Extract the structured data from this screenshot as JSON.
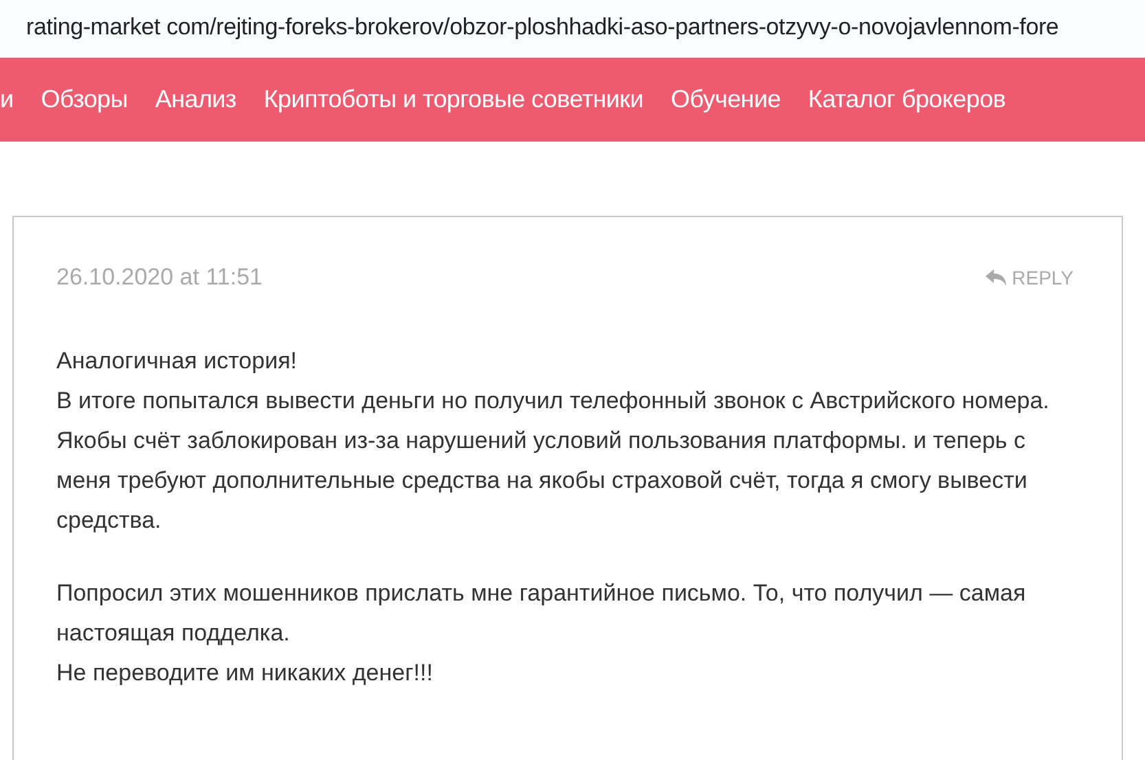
{
  "address_bar": {
    "url": "rating-market com/rejting-foreks-brokerov/obzor-ploshhadki-aso-partners-otzyvy-o-novojavlennom-fore"
  },
  "nav": {
    "items": [
      {
        "label": "и"
      },
      {
        "label": "Обзоры"
      },
      {
        "label": "Анализ"
      },
      {
        "label": "Криптоботы и торговые советники"
      },
      {
        "label": "Обучение"
      },
      {
        "label": "Каталог брокеров"
      }
    ]
  },
  "comment": {
    "date": "26.10.2020 at 11:51",
    "reply": "REPLY",
    "paragraphs": [
      [
        "Аналогичная история!",
        "В итоге попытался вывести деньги но получил телефонный звонок с Австрийского номера. Якобы счёт заблокирован из-за нарушений условий пользования платформы. и теперь с меня требуют дополнительные средства на якобы страховой счёт, тогда я смогу вывести средства."
      ],
      [
        "Попросил этих мошенников прислать мне гарантийное письмо. То, что получил — самая настоящая подделка.",
        "Не переводите им никаких денег!!!"
      ]
    ]
  }
}
